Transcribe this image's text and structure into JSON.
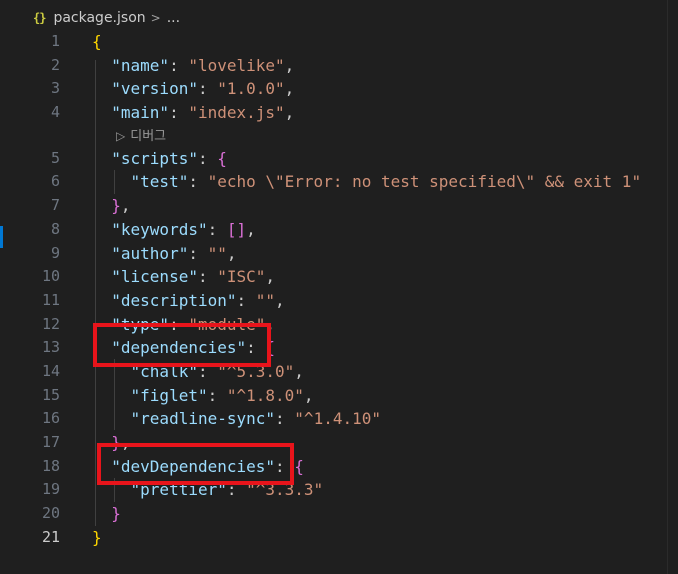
{
  "breadcrumb": {
    "icon": "{}",
    "file": "package.json",
    "separator": ">",
    "more": "..."
  },
  "codelens": {
    "label": "디버그"
  },
  "editor": {
    "lines": [
      {
        "n": "1",
        "tokens": [
          {
            "t": "{",
            "c": "b1"
          }
        ]
      },
      {
        "n": "2",
        "tokens": [
          {
            "t": "  "
          },
          {
            "t": "\"name\"",
            "c": "k"
          },
          {
            "t": ": ",
            "c": "p"
          },
          {
            "t": "\"lovelike\"",
            "c": "s"
          },
          {
            "t": ",",
            "c": "p"
          }
        ]
      },
      {
        "n": "3",
        "tokens": [
          {
            "t": "  "
          },
          {
            "t": "\"version\"",
            "c": "k"
          },
          {
            "t": ": ",
            "c": "p"
          },
          {
            "t": "\"1.0.0\"",
            "c": "s"
          },
          {
            "t": ",",
            "c": "p"
          }
        ]
      },
      {
        "n": "4",
        "tokens": [
          {
            "t": "  "
          },
          {
            "t": "\"main\"",
            "c": "k"
          },
          {
            "t": ": ",
            "c": "p"
          },
          {
            "t": "\"index.js\"",
            "c": "s"
          },
          {
            "t": ",",
            "c": "p"
          }
        ],
        "lens_after": true
      },
      {
        "n": "5",
        "tokens": [
          {
            "t": "  "
          },
          {
            "t": "\"scripts\"",
            "c": "k"
          },
          {
            "t": ": ",
            "c": "p"
          },
          {
            "t": "{",
            "c": "b2"
          }
        ]
      },
      {
        "n": "6",
        "tokens": [
          {
            "t": "    "
          },
          {
            "t": "\"test\"",
            "c": "k"
          },
          {
            "t": ": ",
            "c": "p"
          },
          {
            "t": "\"echo \\\"Error: no test specified\\\" && exit 1\"",
            "c": "s"
          }
        ]
      },
      {
        "n": "7",
        "tokens": [
          {
            "t": "  "
          },
          {
            "t": "}",
            "c": "b2"
          },
          {
            "t": ",",
            "c": "p"
          }
        ]
      },
      {
        "n": "8",
        "tokens": [
          {
            "t": "  "
          },
          {
            "t": "\"keywords\"",
            "c": "k"
          },
          {
            "t": ": ",
            "c": "p"
          },
          {
            "t": "[]",
            "c": "b2"
          },
          {
            "t": ",",
            "c": "p"
          }
        ]
      },
      {
        "n": "9",
        "tokens": [
          {
            "t": "  "
          },
          {
            "t": "\"author\"",
            "c": "k"
          },
          {
            "t": ": ",
            "c": "p"
          },
          {
            "t": "\"\"",
            "c": "s"
          },
          {
            "t": ",",
            "c": "p"
          }
        ]
      },
      {
        "n": "10",
        "tokens": [
          {
            "t": "  "
          },
          {
            "t": "\"license\"",
            "c": "k"
          },
          {
            "t": ": ",
            "c": "p"
          },
          {
            "t": "\"ISC\"",
            "c": "s"
          },
          {
            "t": ",",
            "c": "p"
          }
        ]
      },
      {
        "n": "11",
        "tokens": [
          {
            "t": "  "
          },
          {
            "t": "\"description\"",
            "c": "k"
          },
          {
            "t": ": ",
            "c": "p"
          },
          {
            "t": "\"\"",
            "c": "s"
          },
          {
            "t": ",",
            "c": "p"
          }
        ]
      },
      {
        "n": "12",
        "tokens": [
          {
            "t": "  "
          },
          {
            "t": "\"type\"",
            "c": "k"
          },
          {
            "t": ": ",
            "c": "p"
          },
          {
            "t": "\"module\"",
            "c": "s"
          },
          {
            "t": ",",
            "c": "p"
          }
        ]
      },
      {
        "n": "13",
        "tokens": [
          {
            "t": "  "
          },
          {
            "t": "\"dependencies\"",
            "c": "k"
          },
          {
            "t": ": ",
            "c": "p"
          },
          {
            "t": "{",
            "c": "b2"
          }
        ]
      },
      {
        "n": "14",
        "tokens": [
          {
            "t": "    "
          },
          {
            "t": "\"chalk\"",
            "c": "k"
          },
          {
            "t": ": ",
            "c": "p"
          },
          {
            "t": "\"^5.3.0\"",
            "c": "s"
          },
          {
            "t": ",",
            "c": "p"
          }
        ]
      },
      {
        "n": "15",
        "tokens": [
          {
            "t": "    "
          },
          {
            "t": "\"figlet\"",
            "c": "k"
          },
          {
            "t": ": ",
            "c": "p"
          },
          {
            "t": "\"^1.8.0\"",
            "c": "s"
          },
          {
            "t": ",",
            "c": "p"
          }
        ]
      },
      {
        "n": "16",
        "tokens": [
          {
            "t": "    "
          },
          {
            "t": "\"readline-sync\"",
            "c": "k"
          },
          {
            "t": ": ",
            "c": "p"
          },
          {
            "t": "\"^1.4.10\"",
            "c": "s"
          }
        ]
      },
      {
        "n": "17",
        "tokens": [
          {
            "t": "  "
          },
          {
            "t": "}",
            "c": "b2"
          },
          {
            "t": ",",
            "c": "p"
          }
        ]
      },
      {
        "n": "18",
        "tokens": [
          {
            "t": "  "
          },
          {
            "t": "\"devDependencies\"",
            "c": "k"
          },
          {
            "t": ": ",
            "c": "p"
          },
          {
            "t": "{",
            "c": "b2"
          }
        ]
      },
      {
        "n": "19",
        "tokens": [
          {
            "t": "    "
          },
          {
            "t": "\"prettier\"",
            "c": "k"
          },
          {
            "t": ": ",
            "c": "p"
          },
          {
            "t": "\"^3.3.3\"",
            "c": "s"
          }
        ]
      },
      {
        "n": "20",
        "tokens": [
          {
            "t": "  "
          },
          {
            "t": "}",
            "c": "b2"
          }
        ]
      },
      {
        "n": "21",
        "tokens": [
          {
            "t": "}",
            "c": "b1"
          }
        ],
        "active": true
      }
    ]
  },
  "colors": {
    "background": "#1f1f1f",
    "key": "#9cdcfe",
    "string": "#ce9178",
    "bracket_level1": "#ffd700",
    "bracket_level2": "#da70d6",
    "highlight_box": "#e8141b"
  }
}
